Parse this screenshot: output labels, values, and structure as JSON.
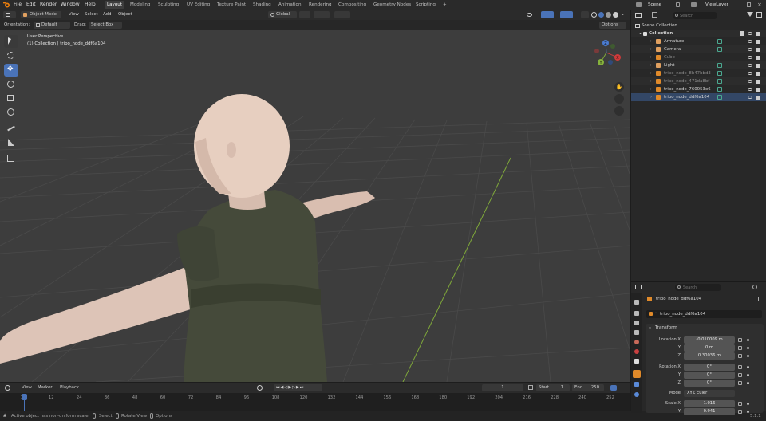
{
  "topbar": {
    "menus": [
      "File",
      "Edit",
      "Render",
      "Window",
      "Help"
    ],
    "workspaces": [
      "Layout",
      "Modeling",
      "Sculpting",
      "UV Editing",
      "Texture Paint",
      "Shading",
      "Animation",
      "Rendering",
      "Compositing",
      "Geometry Nodes",
      "Scripting"
    ],
    "add_tab": "+",
    "scene": "Scene",
    "view_layer": "ViewLayer"
  },
  "viewport_header": {
    "mode": "Object Mode",
    "menus": [
      "View",
      "Select",
      "Add",
      "Object"
    ],
    "transform_orientation": "Global",
    "options": "Options"
  },
  "tool_settings": {
    "orientation_label": "Orientation:",
    "orientation_value": "Default",
    "drag_label": "Drag:",
    "drag_value": "Select Box"
  },
  "viewport": {
    "perspective": "User Perspective",
    "collection_info": "(1) Collection | tripo_node_ddf6a104",
    "gizmo_axes": [
      "X",
      "Y",
      "Z"
    ],
    "colors": {
      "background": "#3d3d3d",
      "grid": "#4a4a4a",
      "y_axis": "#7fa83a"
    }
  },
  "timeline": {
    "menus": [
      "View",
      "Marker",
      "Playback"
    ],
    "current_frame": "1",
    "start_label": "Start",
    "start_value": "1",
    "end_label": "End",
    "end_value": "250",
    "ticks": [
      "1",
      "12",
      "24",
      "36",
      "48",
      "60",
      "72",
      "84",
      "96",
      "108",
      "120",
      "132",
      "144",
      "156",
      "168",
      "180",
      "192",
      "204",
      "216",
      "228",
      "240",
      "252"
    ]
  },
  "statusbar": {
    "message": "Active object has non-uniform scale",
    "select": "Select",
    "rotate": "Rotate View",
    "options": "Options",
    "version": "5.1.1"
  },
  "outliner": {
    "search_placeholder": "Search",
    "scene_collection": "Scene Collection",
    "collection": "Collection",
    "items": [
      {
        "name": "Armature",
        "dim": false,
        "selected": false
      },
      {
        "name": "Camera",
        "dim": false,
        "selected": false
      },
      {
        "name": "Cube",
        "dim": true,
        "selected": false
      },
      {
        "name": "Light",
        "dim": false,
        "selected": false
      },
      {
        "name": "tripo_node_8b47bbd3",
        "dim": true,
        "selected": false
      },
      {
        "name": "tripo_node_471da8bf",
        "dim": true,
        "selected": false
      },
      {
        "name": "tripo_node_760053e6",
        "dim": false,
        "selected": false
      },
      {
        "name": "tripo_node_ddf6a104",
        "dim": false,
        "selected": true
      }
    ]
  },
  "properties": {
    "search_placeholder": "Search",
    "object_name": "tripo_node_ddf6a104",
    "object_field": "tripo_node_ddf6a104",
    "transform_header": "Transform",
    "location": {
      "label": "Location X",
      "y_label": "Y",
      "z_label": "Z",
      "x": "-0.010009 m",
      "y": "0 m",
      "z": "0.30036 m"
    },
    "rotation": {
      "label": "Rotation X",
      "y_label": "Y",
      "z_label": "Z",
      "x": "0°",
      "y": "0°",
      "z": "0°"
    },
    "mode": {
      "label": "Mode",
      "value": "XYZ Euler"
    },
    "scale": {
      "label": "Scale X",
      "y_label": "Y",
      "x": "1.016",
      "y": "0.941"
    }
  }
}
